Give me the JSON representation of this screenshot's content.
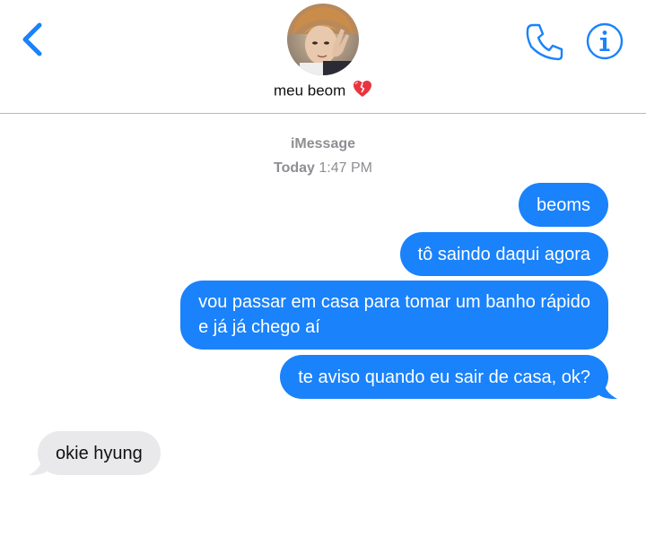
{
  "header": {
    "contact_name": "meu beom",
    "name_emoji": "heart-icon"
  },
  "thread": {
    "service": "iMessage",
    "date_day": "Today",
    "date_time": "1:47 PM"
  },
  "messages": [
    {
      "direction": "sent",
      "text": "beoms"
    },
    {
      "direction": "sent",
      "text": "tô saindo daqui agora"
    },
    {
      "direction": "sent",
      "lines": [
        "vou passar em casa para tomar um banho rápido",
        "e já já chego aí"
      ]
    },
    {
      "direction": "sent",
      "text": "te aviso quando eu sair de casa, ok?"
    },
    {
      "direction": "received",
      "text": "okie hyung"
    }
  ],
  "colors": {
    "accent": "#1a82fb",
    "received_bubble": "#e9e9eb",
    "meta_text": "#8e8e93"
  }
}
